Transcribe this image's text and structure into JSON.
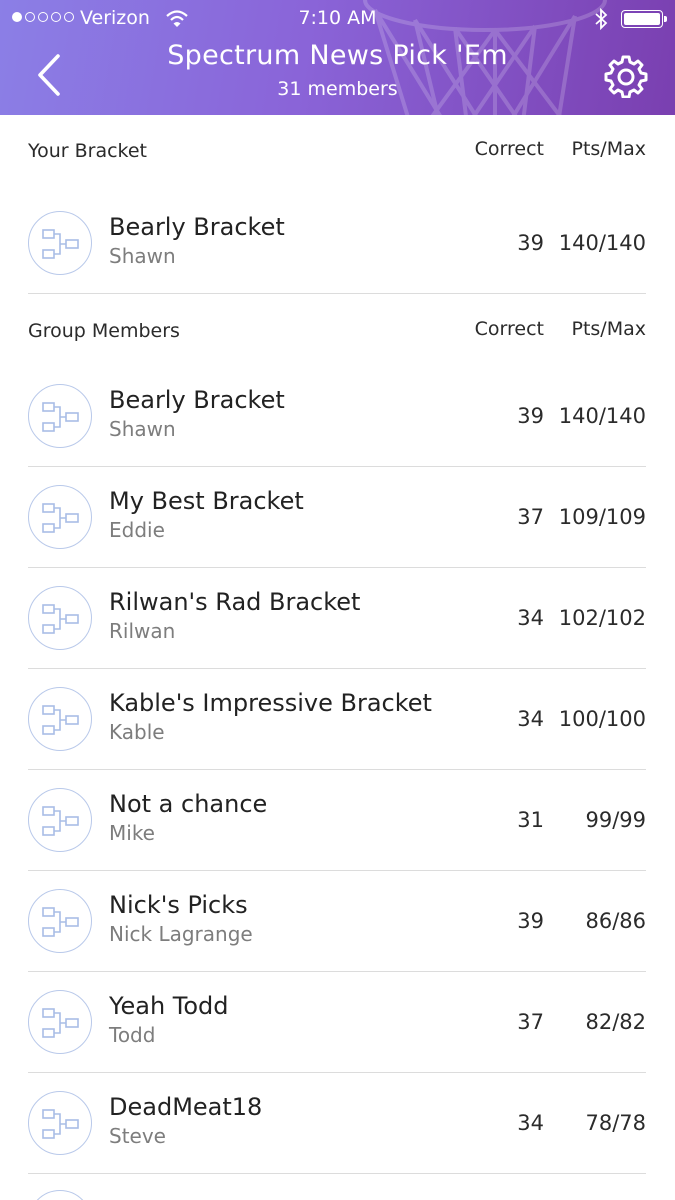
{
  "status_bar": {
    "carrier": "Verizon",
    "time": "7:10 AM"
  },
  "header": {
    "title": "Spectrum News Pick 'Em",
    "subtitle": "31 members"
  },
  "your_bracket": {
    "heading": "Your Bracket",
    "col_correct": "Correct",
    "col_pts": "Pts/Max",
    "row": {
      "name": "Bearly Bracket",
      "owner": "Shawn",
      "correct": "39",
      "pts": "140/140"
    }
  },
  "group": {
    "heading": "Group Members",
    "col_correct": "Correct",
    "col_pts": "Pts/Max",
    "rows": [
      {
        "name": "Bearly Bracket",
        "owner": "Shawn",
        "correct": "39",
        "pts": "140/140"
      },
      {
        "name": "My Best Bracket",
        "owner": "Eddie",
        "correct": "37",
        "pts": "109/109"
      },
      {
        "name": "Rilwan's Rad Bracket",
        "owner": "Rilwan",
        "correct": "34",
        "pts": "102/102"
      },
      {
        "name": "Kable's Impressive Bracket",
        "owner": "Kable",
        "correct": "34",
        "pts": "100/100"
      },
      {
        "name": "Not a chance",
        "owner": "Mike",
        "correct": "31",
        "pts": "99/99"
      },
      {
        "name": "Nick's Picks",
        "owner": "Nick Lagrange",
        "correct": "39",
        "pts": "86/86"
      },
      {
        "name": "Yeah Todd",
        "owner": "Todd",
        "correct": "37",
        "pts": "82/82"
      },
      {
        "name": "DeadMeat18",
        "owner": "Steve",
        "correct": "34",
        "pts": "78/78"
      }
    ]
  },
  "icons": {
    "back": "chevron-left-icon",
    "settings": "gear-icon",
    "avatar": "bracket-icon"
  },
  "colors": {
    "header_start": "#8b7fe6",
    "header_end": "#7a3fb0",
    "avatar_ring": "#b9c9ea"
  }
}
